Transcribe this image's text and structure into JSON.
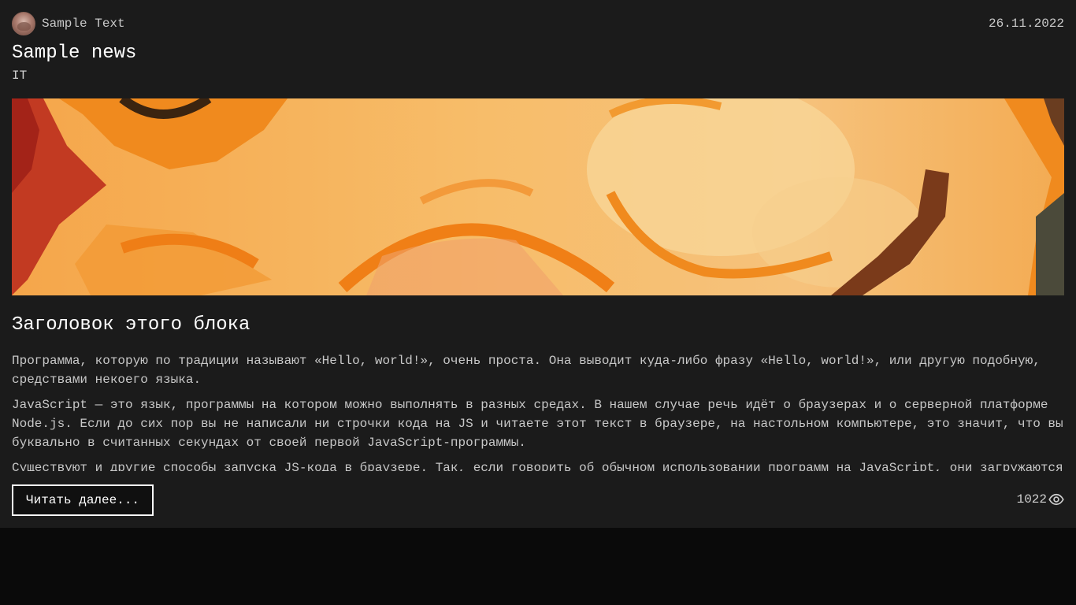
{
  "post": {
    "author_name": "Sample Text",
    "date": "26.11.2022",
    "title": "Sample news",
    "category": "IT",
    "hero_image": "painting-image",
    "block_heading": "Заголовок этого блока",
    "paragraphs": [
      "Программа, которую по традиции называют «Hello, world!», очень проста. Она выводит куда-либо фразу «Hello, world!», или другую подобную, средствами некоего языка.",
      "JavaScript — это язык, программы на котором можно выполнять в разных средах. В нашем случае речь идёт о браузерах и о серверной платформе Node.js. Если до сих пор вы не написали ни строчки кода на JS и читаете этот текст в браузере, на настольном компьютере, это значит, что вы буквально в считанных секундах от своей первой JavaScript-программы.",
      "Существуют и другие способы запуска JS-кода в браузере. Так, если говорить об обычном использовании программ на JavaScript, они загружаются в браузер для обеспечения работы веб-страниц."
    ],
    "read_more_label": "Читать далее...",
    "views_count": "1022",
    "views_icon": "eye-icon"
  },
  "colors": {
    "page_background": "#0a0a0a",
    "card_background": "#1b1b1b",
    "text_primary": "#ffffff",
    "text_secondary": "#c8c8c8"
  }
}
